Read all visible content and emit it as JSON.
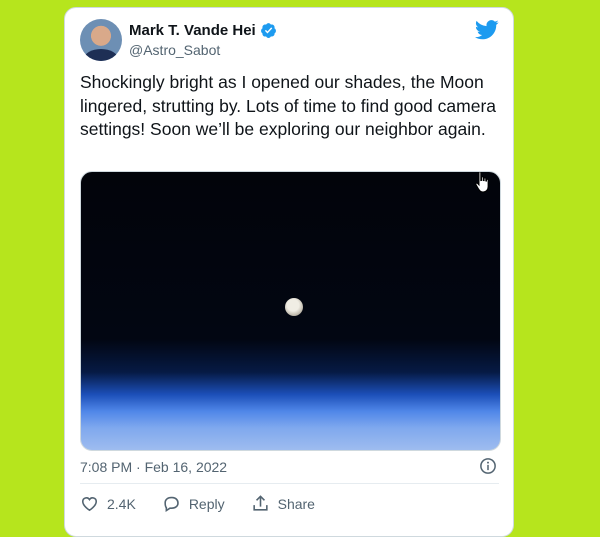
{
  "tweet": {
    "author_name": "Mark T. Vande Hei",
    "handle": "@Astro_Sabot",
    "text": "Shockingly bright as I opened our shades, the Moon lingered, strutting by. Lots of time to find good camera settings! Soon we’ll be exploring our neighbor again.",
    "timestamp": "7:08 PM · Feb 16, 2022",
    "likes": "2.4K",
    "reply_label": "Reply",
    "share_label": "Share"
  },
  "colors": {
    "page_background": "#b6e51d",
    "brand_blue": "#1d9bf0",
    "secondary_text": "#536471"
  },
  "icons": {
    "verified": "verified-badge-icon",
    "logo": "twitter-bird-icon",
    "info": "info-icon",
    "like": "heart-icon",
    "reply": "reply-bubble-icon",
    "share": "share-upload-icon",
    "cursor": "hand-pointer-cursor-icon"
  }
}
